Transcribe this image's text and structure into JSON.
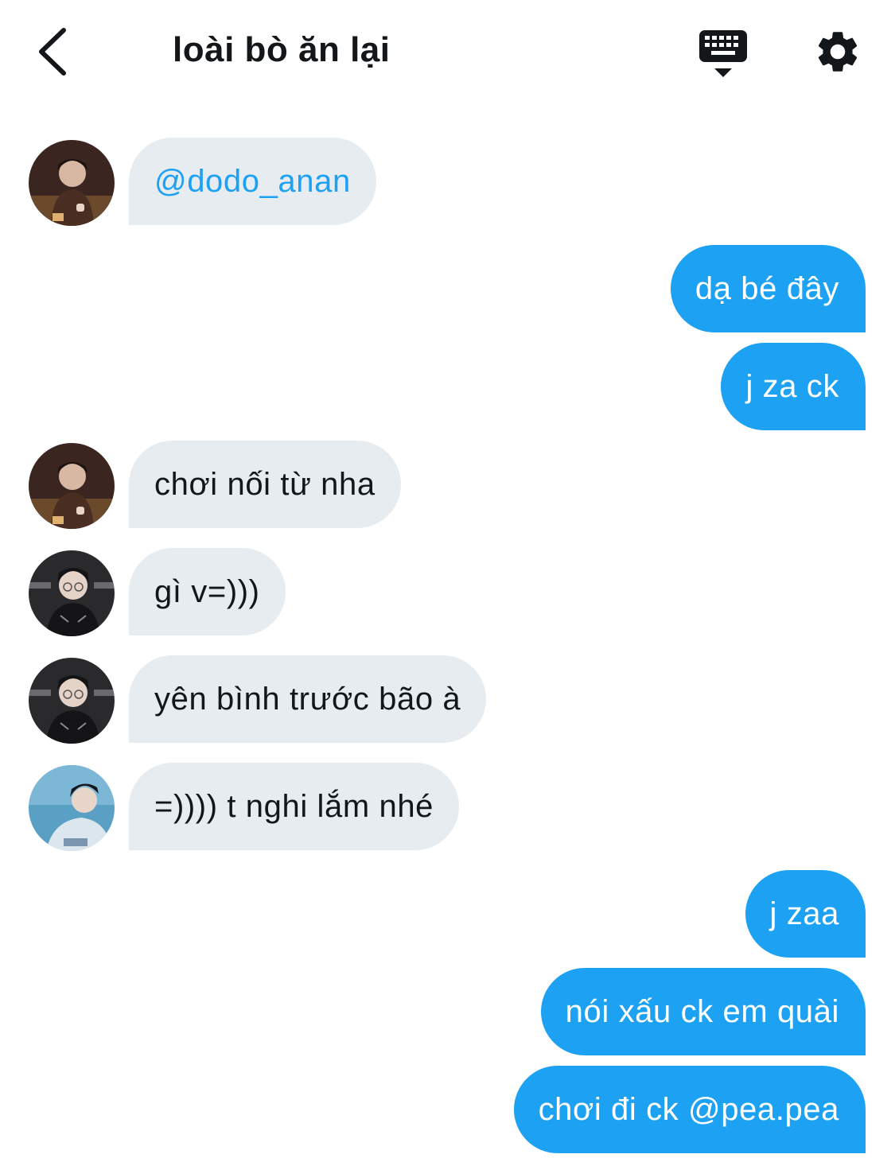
{
  "header": {
    "title": "loài bò ăn lại",
    "back_icon": "chevron-left-icon",
    "keyboard_icon": "keyboard-hide-icon",
    "settings_icon": "gear-icon"
  },
  "colors": {
    "accent": "#1da1f2",
    "incoming_bubble": "#e6ecf0",
    "text": "#14171a"
  },
  "messages": [
    {
      "direction": "in",
      "sender": "avatar-a",
      "text": "@dodo_anan",
      "mention": true
    },
    {
      "direction": "out",
      "text": "dạ bé đây"
    },
    {
      "direction": "out",
      "text": "j za ck"
    },
    {
      "direction": "in",
      "sender": "avatar-a",
      "text": "chơi nối từ nha"
    },
    {
      "direction": "in",
      "sender": "avatar-b",
      "text": "gì v=)))"
    },
    {
      "direction": "in",
      "sender": "avatar-b",
      "text": "yên bình trước bão à"
    },
    {
      "direction": "in",
      "sender": "avatar-c",
      "text": "=)))) t nghi lắm nhé"
    },
    {
      "direction": "out",
      "text": "j zaa"
    },
    {
      "direction": "out",
      "text": "nói xấu ck em quài"
    },
    {
      "direction": "out",
      "text": "chơi đi ck @pea.pea"
    }
  ]
}
